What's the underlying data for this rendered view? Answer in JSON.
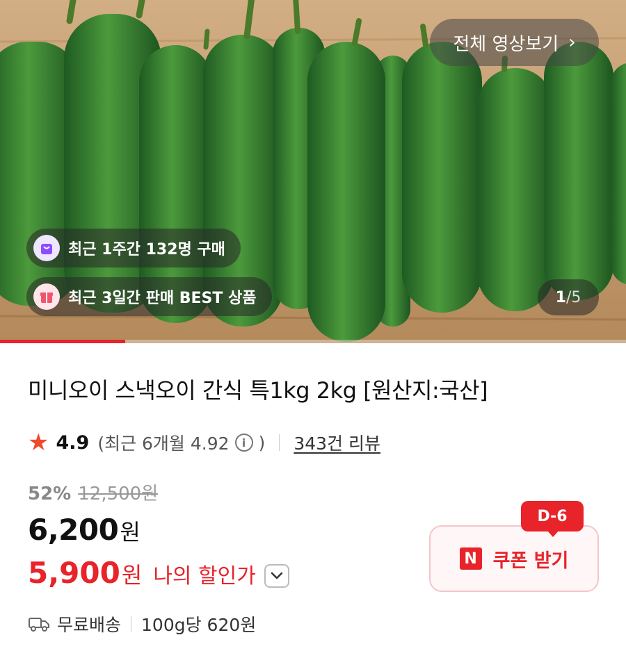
{
  "gallery": {
    "video_button_label": "전체 영상보기",
    "badges": [
      {
        "icon": "shopping-bag-icon",
        "text": "최근 1주간 132명 구매"
      },
      {
        "icon": "gift-icon",
        "text": "최근 3일간 판매 BEST 상품"
      }
    ],
    "counter": {
      "current": "1",
      "separator": "/",
      "total": "5"
    },
    "progress_fraction": 0.2,
    "accent": "#e8232a"
  },
  "product": {
    "title": "미니오이 스낵오이 간식 특1kg 2kg [원산지:국산]",
    "rating": "4.9",
    "rating_recent_prefix": "(최근 6개월 4.92",
    "rating_recent_suffix": ")",
    "review_link": "343건 리뷰",
    "discount_rate": "52%",
    "original_price": "12,500원",
    "price": "6,200",
    "price_unit": "원",
    "my_price": "5,900",
    "my_price_unit": "원",
    "my_price_label": "나의 할인가",
    "shipping": "무료배송",
    "unit_price": "100g당 620원"
  },
  "coupon": {
    "label": "쿠폰 받기",
    "logo": "N",
    "dday": "D-6"
  }
}
